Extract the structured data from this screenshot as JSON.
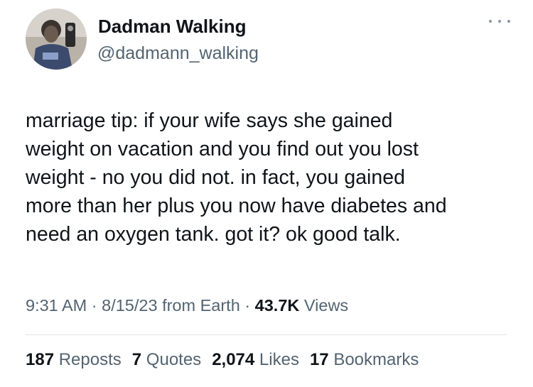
{
  "author": {
    "display_name": "Dadman Walking",
    "handle": "@dadmann_walking"
  },
  "tweet": {
    "text": "marriage tip:  if your wife says she gained\nweight on vacation and you find out you lost\nweight - no you did not. in fact, you gained\nmore than her plus you now have diabetes and\nneed an oxygen tank. got it? ok good talk."
  },
  "meta": {
    "time": "9:31 AM",
    "sep1": "·",
    "date": "8/15/23",
    "source": "from Earth",
    "sep2": "·",
    "views_count": "43.7K",
    "views_label": "Views"
  },
  "stats": [
    {
      "count": "187",
      "label": "Reposts"
    },
    {
      "count": "7",
      "label": "Quotes"
    },
    {
      "count": "2,074",
      "label": "Likes"
    },
    {
      "count": "17",
      "label": "Bookmarks"
    }
  ],
  "icons": {
    "more": "more-horizontal-icon"
  }
}
